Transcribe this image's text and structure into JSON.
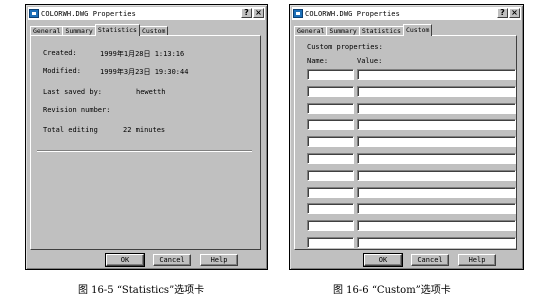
{
  "dialog1": {
    "title": "COLORWH.DWG Properties",
    "help_btn": "?",
    "close_btn": "×",
    "tabs": [
      "General",
      "Summary",
      "Statistics",
      "Custom"
    ],
    "active_tab": "Statistics",
    "stats": {
      "created_label": "Created:",
      "created_value": "1999年1月28日  1:13:16",
      "modified_label": "Modified:",
      "modified_value": "1999年3月23日  19:30:44",
      "last_saved_label": "Last saved by:",
      "last_saved_value": "hewetth",
      "revision_label": "Revision number:",
      "revision_value": "",
      "editing_label": "Total editing",
      "editing_value": "22 minutes"
    },
    "buttons": {
      "ok": "OK",
      "cancel": "Cancel",
      "help": "Help"
    }
  },
  "dialog2": {
    "title": "COLORWH.DWG Properties",
    "help_btn": "?",
    "close_btn": "×",
    "tabs": [
      "General",
      "Summary",
      "Statistics",
      "Custom"
    ],
    "active_tab": "Custom",
    "custom": {
      "heading": "Custom properties:",
      "name_label": "Name:",
      "value_label": "Value:"
    },
    "buttons": {
      "ok": "OK",
      "cancel": "Cancel",
      "help": "Help"
    }
  },
  "captions": {
    "fig1": "图 16-5 “Statistics”选项卡",
    "fig2": "图 16-6 “Custom”选项卡"
  },
  "colors": {
    "dialog_face": "#c0c0c0",
    "title_bar": "#ffffff",
    "app_icon": "#1c6fb8"
  }
}
